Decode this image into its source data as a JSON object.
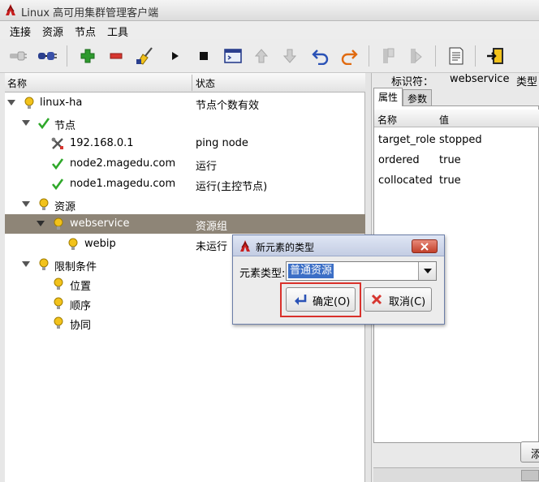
{
  "window": {
    "title": "Linux 高可用集群管理客户端"
  },
  "menu": [
    "连接",
    "资源",
    "节点",
    "工具"
  ],
  "tree": {
    "columns": {
      "name": "名称",
      "status": "状态"
    },
    "rows": [
      {
        "label": "linux-ha",
        "status": "节点个数有效"
      },
      {
        "label": "节点",
        "status": ""
      },
      {
        "label": "192.168.0.1",
        "status": "ping node"
      },
      {
        "label": "node2.magedu.com",
        "status": "运行"
      },
      {
        "label": "node1.magedu.com",
        "status": "运行(主控节点)"
      },
      {
        "label": "资源",
        "status": ""
      },
      {
        "label": "webservice",
        "status": "资源组"
      },
      {
        "label": "webip",
        "status": "未运行"
      },
      {
        "label": "限制条件",
        "status": ""
      },
      {
        "label": "位置",
        "status": ""
      },
      {
        "label": "顺序",
        "status": ""
      },
      {
        "label": "协同",
        "status": ""
      }
    ]
  },
  "details": {
    "id_label": "标识符：",
    "id_value": "webservice",
    "type_label": "类型",
    "tabs": [
      "属性",
      "参数"
    ],
    "columns": {
      "name": "名称",
      "value": "值"
    },
    "props": [
      {
        "name": "target_role",
        "value": "stopped"
      },
      {
        "name": "ordered",
        "value": "true"
      },
      {
        "name": "collocated",
        "value": "true"
      }
    ],
    "apply_label": "添加"
  },
  "dialog": {
    "title": "新元素的类型",
    "element_type_label": "元素类型:",
    "element_type_value": "普通资源",
    "ok_label": "确定(O)",
    "cancel_label": "取消(C)"
  },
  "colors": {
    "selection": "#8e8577",
    "highlight": "#d9312b",
    "bulb": "#f2c21b",
    "check": "#2fa82a"
  }
}
